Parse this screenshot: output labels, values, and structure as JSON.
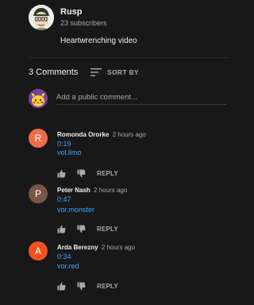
{
  "channel": {
    "name": "Rusp",
    "subscribers": "23 subscribers",
    "description": "Heartwrenching video"
  },
  "comments_header": {
    "count": "3 Comments",
    "sort_label": "SORT BY",
    "sort_icon": "sort-icon"
  },
  "add_comment": {
    "placeholder": "Add a public comment..."
  },
  "colors": {
    "link": "#3ea6ff",
    "background": "#181818"
  },
  "comments": [
    {
      "initial": "R",
      "avatar_color": "#ef6c4b",
      "author": "Romonda Ororke",
      "time": "2 hours ago",
      "timestamp_link": "0:19",
      "text_link": "vol.limo",
      "reply_label": "REPLY"
    },
    {
      "initial": "P",
      "avatar_color": "#795548",
      "author": "Peter Nash",
      "time": "2 hours ago",
      "timestamp_link": "0:47",
      "text_link": "vor.monster",
      "reply_label": "REPLY"
    },
    {
      "initial": "A",
      "avatar_color": "#f4511e",
      "author": "Arda Berezny",
      "time": "2 hours ago",
      "timestamp_link": "0:34",
      "text_link": "vor.red",
      "reply_label": "REPLY"
    }
  ]
}
